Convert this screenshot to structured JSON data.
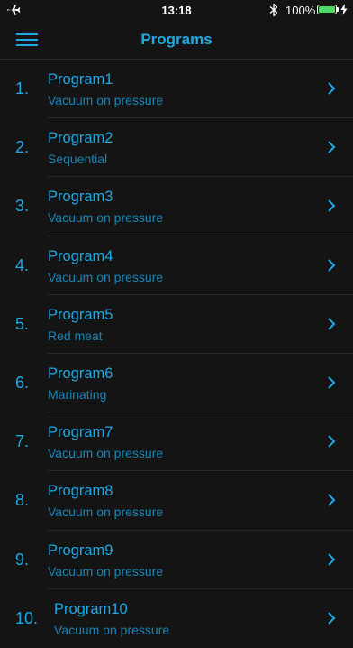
{
  "status_bar": {
    "time": "13:18",
    "battery_percent": "100%",
    "airplane_icon": "airplane-icon",
    "bluetooth_icon": "bluetooth-icon",
    "battery_icon": "battery-icon",
    "battery_color": "#4cd964"
  },
  "nav": {
    "title": "Programs",
    "menu_icon": "hamburger-menu-icon"
  },
  "colors": {
    "background": "#141414",
    "accent": "#1fa8e3",
    "subtitle": "#1b84b5"
  },
  "programs": [
    {
      "index": "1.",
      "name": "Program1",
      "mode": "Vacuum on pressure"
    },
    {
      "index": "2.",
      "name": "Program2",
      "mode": "Sequential"
    },
    {
      "index": "3.",
      "name": "Program3",
      "mode": "Vacuum on pressure"
    },
    {
      "index": "4.",
      "name": "Program4",
      "mode": "Vacuum on pressure"
    },
    {
      "index": "5.",
      "name": "Program5",
      "mode": "Red meat"
    },
    {
      "index": "6.",
      "name": "Program6",
      "mode": "Marinating"
    },
    {
      "index": "7.",
      "name": "Program7",
      "mode": "Vacuum on pressure"
    },
    {
      "index": "8.",
      "name": "Program8",
      "mode": "Vacuum on pressure"
    },
    {
      "index": "9.",
      "name": "Program9",
      "mode": "Vacuum on pressure"
    },
    {
      "index": "10.",
      "name": "Program10",
      "mode": "Vacuum on pressure"
    }
  ]
}
